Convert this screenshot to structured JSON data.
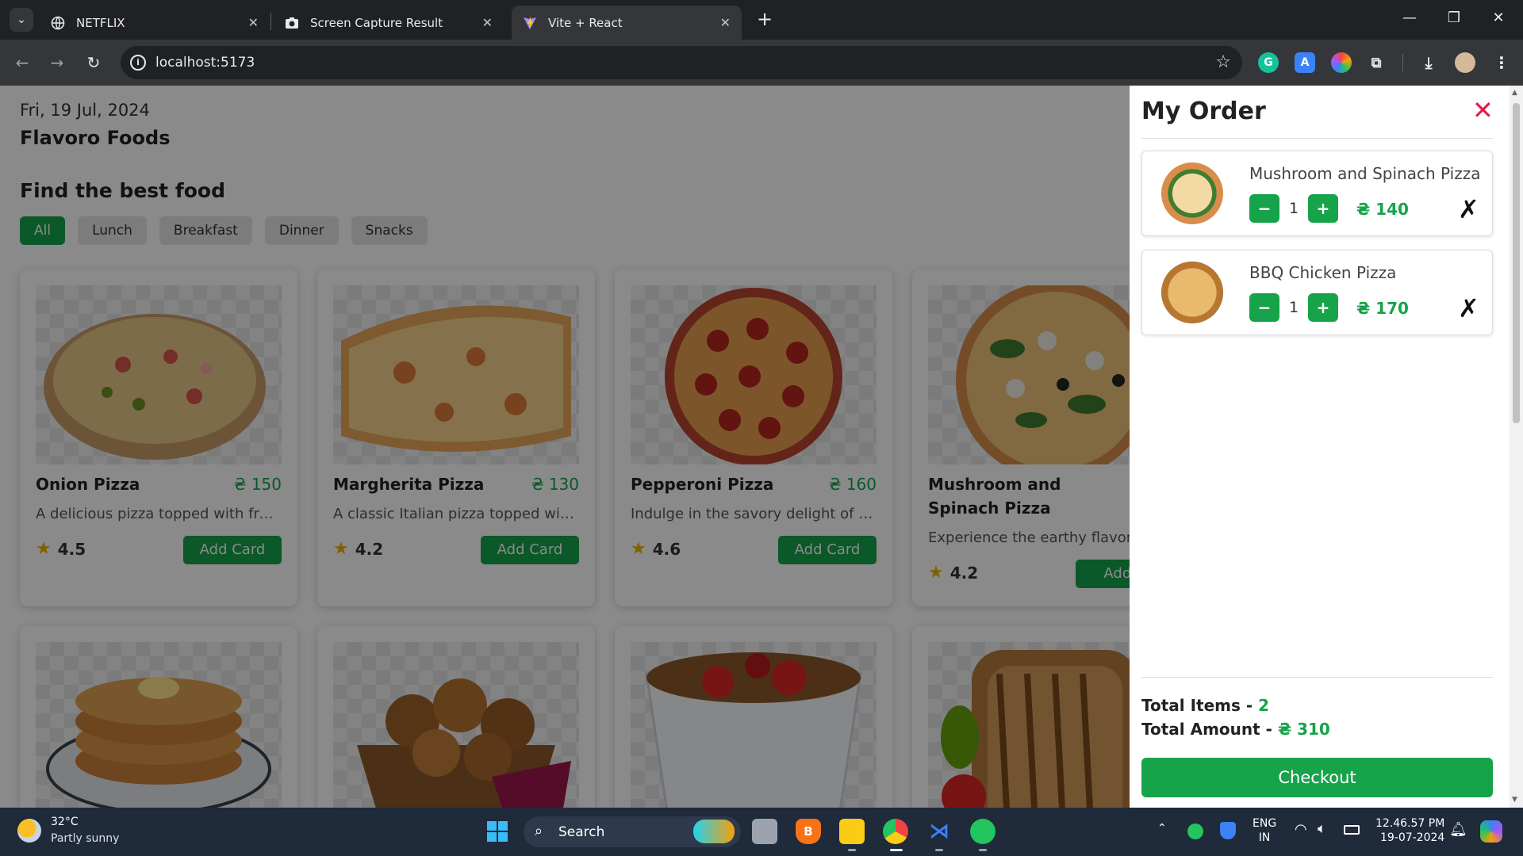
{
  "browser": {
    "tabs": [
      {
        "title": "NETFLIX",
        "active": false
      },
      {
        "title": "Screen Capture Result",
        "active": false
      },
      {
        "title": "Vite + React",
        "active": true
      }
    ],
    "url": "localhost:5173"
  },
  "page": {
    "date": "Fri, 19 Jul, 2024",
    "brand": "Flavoro Foods",
    "heading": "Find the best food",
    "filters": [
      "All",
      "Lunch",
      "Breakfast",
      "Dinner",
      "Snacks"
    ],
    "active_filter": "All",
    "cards": [
      {
        "name": "Onion Pizza",
        "price": "₴ 150",
        "desc": "A delicious pizza topped with fres...",
        "rating": "4.5",
        "button": "Add Card"
      },
      {
        "name": "Margherita Pizza",
        "price": "₴ 130",
        "desc": "A classic Italian pizza topped with ...",
        "rating": "4.2",
        "button": "Add Card"
      },
      {
        "name": "Pepperoni Pizza",
        "price": "₴ 160",
        "desc": "Indulge in the savory delight of thi...",
        "rating": "4.6",
        "button": "Add Card"
      },
      {
        "name": "Mushroom and Spinach Pizza",
        "price": "",
        "desc": "Experience the earthy flavors",
        "rating": "4.2",
        "button": "Add C"
      }
    ]
  },
  "order": {
    "title": "My Order",
    "items": [
      {
        "name": "Mushroom and Spinach Pizza",
        "qty": "1",
        "price": "₴ 140",
        "minus": "−",
        "plus": "+",
        "remove": "✗"
      },
      {
        "name": "BBQ Chicken Pizza",
        "qty": "1",
        "price": "₴ 170",
        "minus": "−",
        "plus": "+",
        "remove": "✗"
      }
    ],
    "total_items_label": "Total Items - ",
    "total_items": "2",
    "total_amount_label": "Total Amount - ",
    "total_amount": "₴ 310",
    "checkout": "Checkout"
  },
  "taskbar": {
    "temp": "32°C",
    "weather": "Partly sunny",
    "search": "Search",
    "lang": "ENG",
    "region": "IN",
    "time": "12.46.57 PM",
    "date": "19-07-2024"
  },
  "colors": {
    "accent": "#16a34a",
    "close": "#e11d48"
  }
}
